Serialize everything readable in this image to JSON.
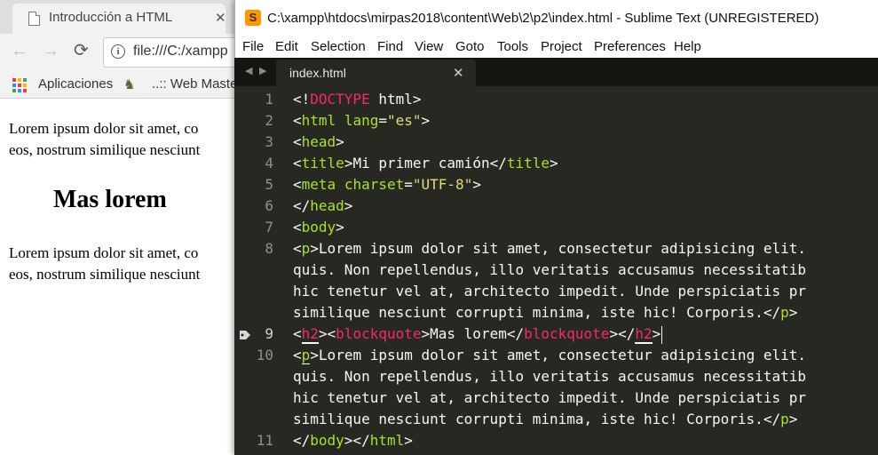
{
  "browser": {
    "tab_title": "Introducción a HTML",
    "tab_close": "✕",
    "back": "←",
    "forward": "→",
    "reload": "⟳",
    "info": "i",
    "url": "file:///C:/xampp",
    "bookmarks": [
      {
        "label": "Aplicaciones"
      },
      {
        "label": "..:: Web Master"
      }
    ],
    "page": {
      "para1_line1": "Lorem ipsum dolor sit amet, co",
      "para1_line2": "eos, nostrum similique nesciunt",
      "heading": "Mas lorem",
      "para2_line1": "Lorem ipsum dolor sit amet, co",
      "para2_line2": "eos, nostrum similique nesciunt"
    }
  },
  "sublime": {
    "logo": "S",
    "title": "C:\\xampp\\htdocs\\mirpas2018\\content\\Web\\2\\p2\\index.html - Sublime Text (UNREGISTERED)",
    "menu": [
      "File",
      "Edit",
      "Selection",
      "Find",
      "View",
      "Goto",
      "Tools",
      "Project",
      "Preferences",
      "Help"
    ],
    "tab_prev": "◀",
    "tab_next": "▶",
    "tab_title": "index.html",
    "tab_close": "✕",
    "bookmark_icon": "bookmark-icon",
    "gutter": [
      "1",
      "2",
      "3",
      "4",
      "5",
      "6",
      "7",
      "8",
      "9",
      "10",
      "11"
    ],
    "code": {
      "l1": [
        "<!",
        "DOCTYPE",
        " html>"
      ],
      "l2": [
        "<",
        "html",
        " ",
        "lang",
        "=",
        "\"es\"",
        ">"
      ],
      "l3": [
        "<",
        "head",
        ">"
      ],
      "l4": [
        "<",
        "title",
        ">",
        "Mi primer camión",
        "</",
        "title",
        ">"
      ],
      "l5": [
        "<",
        "meta",
        " ",
        "charset",
        "=",
        "\"UTF-8\"",
        ">"
      ],
      "l6": [
        "</",
        "head",
        ">"
      ],
      "l7": [
        "<",
        "body",
        ">"
      ],
      "l8a": [
        "<",
        "p",
        ">",
        "Lorem ipsum dolor sit amet, consectetur adipisicing elit."
      ],
      "l8b": "quis. Non repellendus, illo veritatis accusamus necessitatib",
      "l8c": "hic tenetur vel at, architecto impedit. Unde perspiciatis pr",
      "l8d": [
        "similique nesciunt corrupti minima, iste hic! Corporis.",
        "</",
        "p",
        ">"
      ],
      "l9": [
        "<",
        "h2",
        "><",
        "blockquote",
        ">",
        "Mas lorem",
        "</",
        "blockquote",
        "></",
        "h2",
        ">"
      ],
      "l10a": [
        "<",
        "p",
        ">",
        "Lorem ipsum dolor sit amet, consectetur adipisicing elit."
      ],
      "l10b": "quis. Non repellendus, illo veritatis accusamus necessitatib",
      "l10c": "hic tenetur vel at, architecto impedit. Unde perspiciatis pr",
      "l10d": [
        "similique nesciunt corrupti minima, iste hic! Corporis.",
        "</",
        "p",
        ">"
      ],
      "l11": [
        "</",
        "body",
        "></",
        "html",
        ">"
      ]
    }
  },
  "colors": {
    "editor_bg": "#272822",
    "tag": "#a6e22e",
    "keyword": "#f92672",
    "string": "#e6db74",
    "text": "#f8f8f2",
    "gutter": "#90908a"
  }
}
